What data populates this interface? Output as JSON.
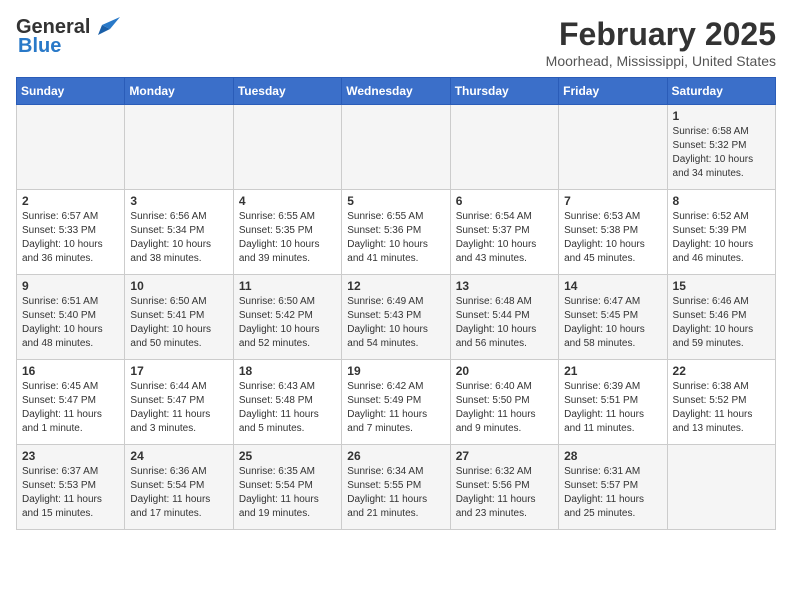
{
  "header": {
    "logo_general": "General",
    "logo_blue": "Blue",
    "month_title": "February 2025",
    "location": "Moorhead, Mississippi, United States"
  },
  "days_of_week": [
    "Sunday",
    "Monday",
    "Tuesday",
    "Wednesday",
    "Thursday",
    "Friday",
    "Saturday"
  ],
  "weeks": [
    [
      {
        "day": "",
        "info": ""
      },
      {
        "day": "",
        "info": ""
      },
      {
        "day": "",
        "info": ""
      },
      {
        "day": "",
        "info": ""
      },
      {
        "day": "",
        "info": ""
      },
      {
        "day": "",
        "info": ""
      },
      {
        "day": "1",
        "info": "Sunrise: 6:58 AM\nSunset: 5:32 PM\nDaylight: 10 hours and 34 minutes."
      }
    ],
    [
      {
        "day": "2",
        "info": "Sunrise: 6:57 AM\nSunset: 5:33 PM\nDaylight: 10 hours and 36 minutes."
      },
      {
        "day": "3",
        "info": "Sunrise: 6:56 AM\nSunset: 5:34 PM\nDaylight: 10 hours and 38 minutes."
      },
      {
        "day": "4",
        "info": "Sunrise: 6:55 AM\nSunset: 5:35 PM\nDaylight: 10 hours and 39 minutes."
      },
      {
        "day": "5",
        "info": "Sunrise: 6:55 AM\nSunset: 5:36 PM\nDaylight: 10 hours and 41 minutes."
      },
      {
        "day": "6",
        "info": "Sunrise: 6:54 AM\nSunset: 5:37 PM\nDaylight: 10 hours and 43 minutes."
      },
      {
        "day": "7",
        "info": "Sunrise: 6:53 AM\nSunset: 5:38 PM\nDaylight: 10 hours and 45 minutes."
      },
      {
        "day": "8",
        "info": "Sunrise: 6:52 AM\nSunset: 5:39 PM\nDaylight: 10 hours and 46 minutes."
      }
    ],
    [
      {
        "day": "9",
        "info": "Sunrise: 6:51 AM\nSunset: 5:40 PM\nDaylight: 10 hours and 48 minutes."
      },
      {
        "day": "10",
        "info": "Sunrise: 6:50 AM\nSunset: 5:41 PM\nDaylight: 10 hours and 50 minutes."
      },
      {
        "day": "11",
        "info": "Sunrise: 6:50 AM\nSunset: 5:42 PM\nDaylight: 10 hours and 52 minutes."
      },
      {
        "day": "12",
        "info": "Sunrise: 6:49 AM\nSunset: 5:43 PM\nDaylight: 10 hours and 54 minutes."
      },
      {
        "day": "13",
        "info": "Sunrise: 6:48 AM\nSunset: 5:44 PM\nDaylight: 10 hours and 56 minutes."
      },
      {
        "day": "14",
        "info": "Sunrise: 6:47 AM\nSunset: 5:45 PM\nDaylight: 10 hours and 58 minutes."
      },
      {
        "day": "15",
        "info": "Sunrise: 6:46 AM\nSunset: 5:46 PM\nDaylight: 10 hours and 59 minutes."
      }
    ],
    [
      {
        "day": "16",
        "info": "Sunrise: 6:45 AM\nSunset: 5:47 PM\nDaylight: 11 hours and 1 minute."
      },
      {
        "day": "17",
        "info": "Sunrise: 6:44 AM\nSunset: 5:47 PM\nDaylight: 11 hours and 3 minutes."
      },
      {
        "day": "18",
        "info": "Sunrise: 6:43 AM\nSunset: 5:48 PM\nDaylight: 11 hours and 5 minutes."
      },
      {
        "day": "19",
        "info": "Sunrise: 6:42 AM\nSunset: 5:49 PM\nDaylight: 11 hours and 7 minutes."
      },
      {
        "day": "20",
        "info": "Sunrise: 6:40 AM\nSunset: 5:50 PM\nDaylight: 11 hours and 9 minutes."
      },
      {
        "day": "21",
        "info": "Sunrise: 6:39 AM\nSunset: 5:51 PM\nDaylight: 11 hours and 11 minutes."
      },
      {
        "day": "22",
        "info": "Sunrise: 6:38 AM\nSunset: 5:52 PM\nDaylight: 11 hours and 13 minutes."
      }
    ],
    [
      {
        "day": "23",
        "info": "Sunrise: 6:37 AM\nSunset: 5:53 PM\nDaylight: 11 hours and 15 minutes."
      },
      {
        "day": "24",
        "info": "Sunrise: 6:36 AM\nSunset: 5:54 PM\nDaylight: 11 hours and 17 minutes."
      },
      {
        "day": "25",
        "info": "Sunrise: 6:35 AM\nSunset: 5:54 PM\nDaylight: 11 hours and 19 minutes."
      },
      {
        "day": "26",
        "info": "Sunrise: 6:34 AM\nSunset: 5:55 PM\nDaylight: 11 hours and 21 minutes."
      },
      {
        "day": "27",
        "info": "Sunrise: 6:32 AM\nSunset: 5:56 PM\nDaylight: 11 hours and 23 minutes."
      },
      {
        "day": "28",
        "info": "Sunrise: 6:31 AM\nSunset: 5:57 PM\nDaylight: 11 hours and 25 minutes."
      },
      {
        "day": "",
        "info": ""
      }
    ]
  ]
}
